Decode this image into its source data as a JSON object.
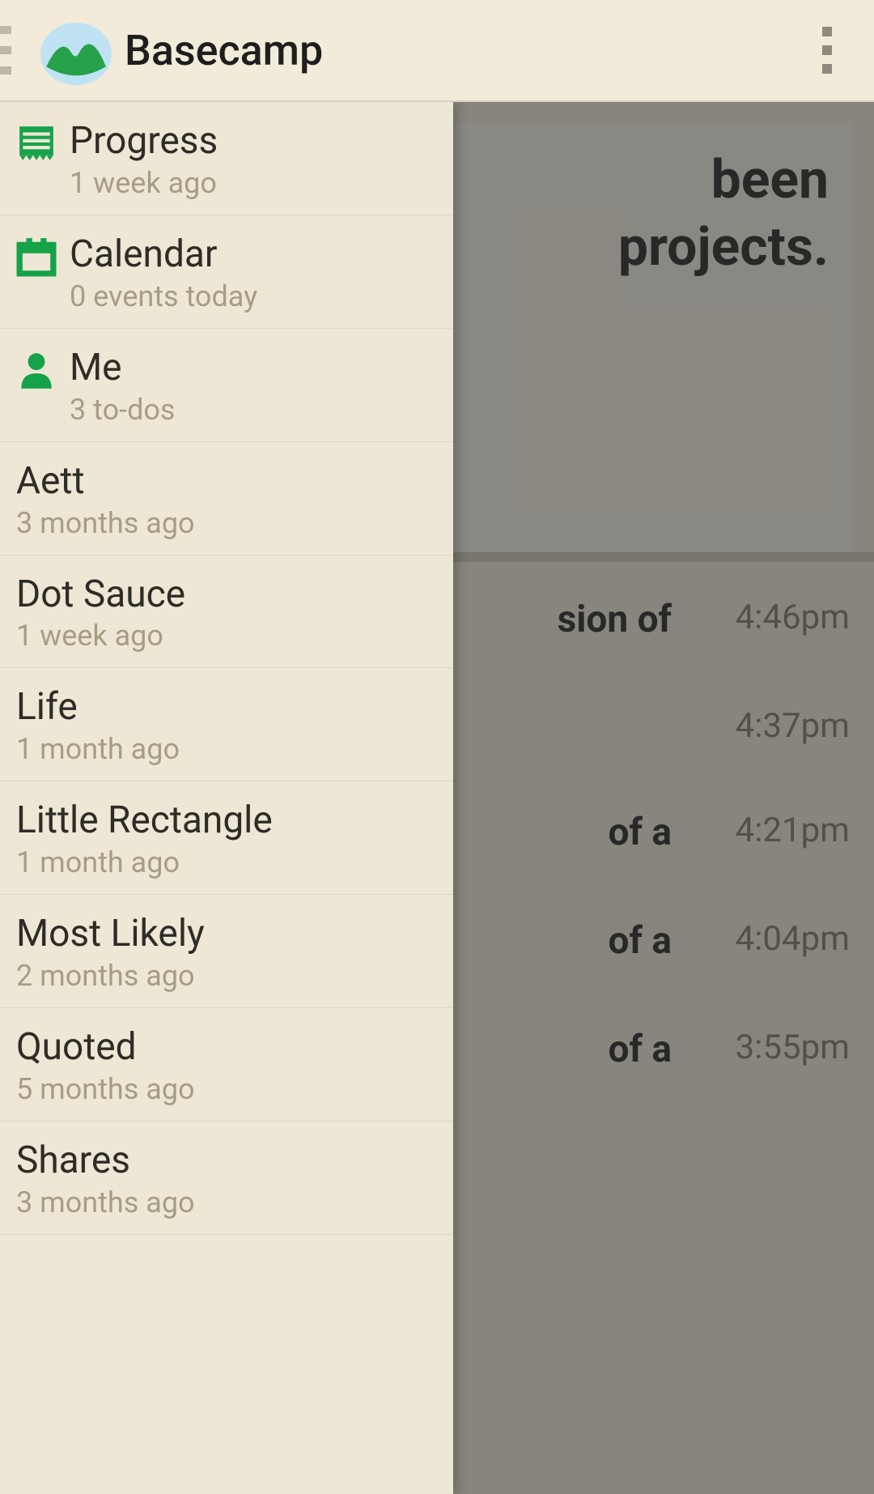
{
  "header": {
    "app_title": "Basecamp"
  },
  "drawer": {
    "fixed": [
      {
        "label": "Progress",
        "sub": "1 week ago",
        "icon": "progress"
      },
      {
        "label": "Calendar",
        "sub": "0 events today",
        "icon": "calendar"
      },
      {
        "label": "Me",
        "sub": "3 to-dos",
        "icon": "person"
      }
    ],
    "projects": [
      {
        "label": "Aett",
        "sub": "3 months ago"
      },
      {
        "label": "Dot Sauce",
        "sub": "1 week ago"
      },
      {
        "label": "Life",
        "sub": "1 month ago"
      },
      {
        "label": "Little Rectangle",
        "sub": "1 month ago"
      },
      {
        "label": "Most Likely",
        "sub": "2 months ago"
      },
      {
        "label": "Quoted",
        "sub": "5 months ago"
      },
      {
        "label": "Shares",
        "sub": "3 months ago"
      }
    ]
  },
  "background": {
    "headline_line1": "been",
    "headline_line2": "projects.",
    "rows": [
      {
        "text": "sion of",
        "time": "4:46pm"
      },
      {
        "text": "",
        "time": "4:37pm"
      },
      {
        "text": "of a",
        "time": "4:21pm"
      },
      {
        "text": "of a",
        "time": "4:04pm"
      },
      {
        "text": "of a",
        "time": "3:55pm"
      }
    ]
  }
}
